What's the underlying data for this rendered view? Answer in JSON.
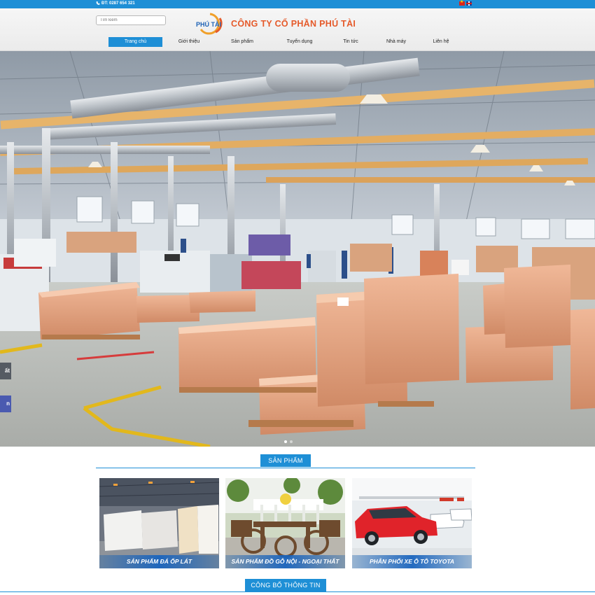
{
  "topbar": {
    "phone": "ĐT: 0287 654 321",
    "phone_icon": "phone-icon",
    "languages": [
      "Tiếng Việt",
      "English"
    ]
  },
  "header": {
    "search_placeholder": "Tìm kiếm",
    "logo_text": "PHÚ TÀI",
    "company_name": "CÔNG TY CỔ PHẦN PHÚ TÀI"
  },
  "nav": {
    "items": [
      {
        "label": "Trang chủ",
        "active": true
      },
      {
        "label": "Giới thiệu",
        "active": false
      },
      {
        "label": "Sản phẩm",
        "active": false
      },
      {
        "label": "Tuyển dụng",
        "active": false
      },
      {
        "label": "Tin tức",
        "active": false
      },
      {
        "label": "Nhà máy",
        "active": false
      },
      {
        "label": "Liên hệ",
        "active": false
      }
    ]
  },
  "side_tabs": [
    "ất",
    "n"
  ],
  "products": {
    "title": "SẢN PHẨM",
    "cards": [
      {
        "caption": "SẢN PHẨM ĐÁ ỐP LÁT"
      },
      {
        "caption": "SẢN PHẨM ĐỒ GỖ NỘI - NGOẠI THẤT"
      },
      {
        "caption": "PHÂN PHỐI XE Ô TÔ TOYOTA"
      }
    ]
  },
  "info": {
    "title": "CÔNG BỐ THÔNG TIN"
  },
  "colors": {
    "accent": "#1e8fd6",
    "brand_orange": "#e55a2a"
  }
}
